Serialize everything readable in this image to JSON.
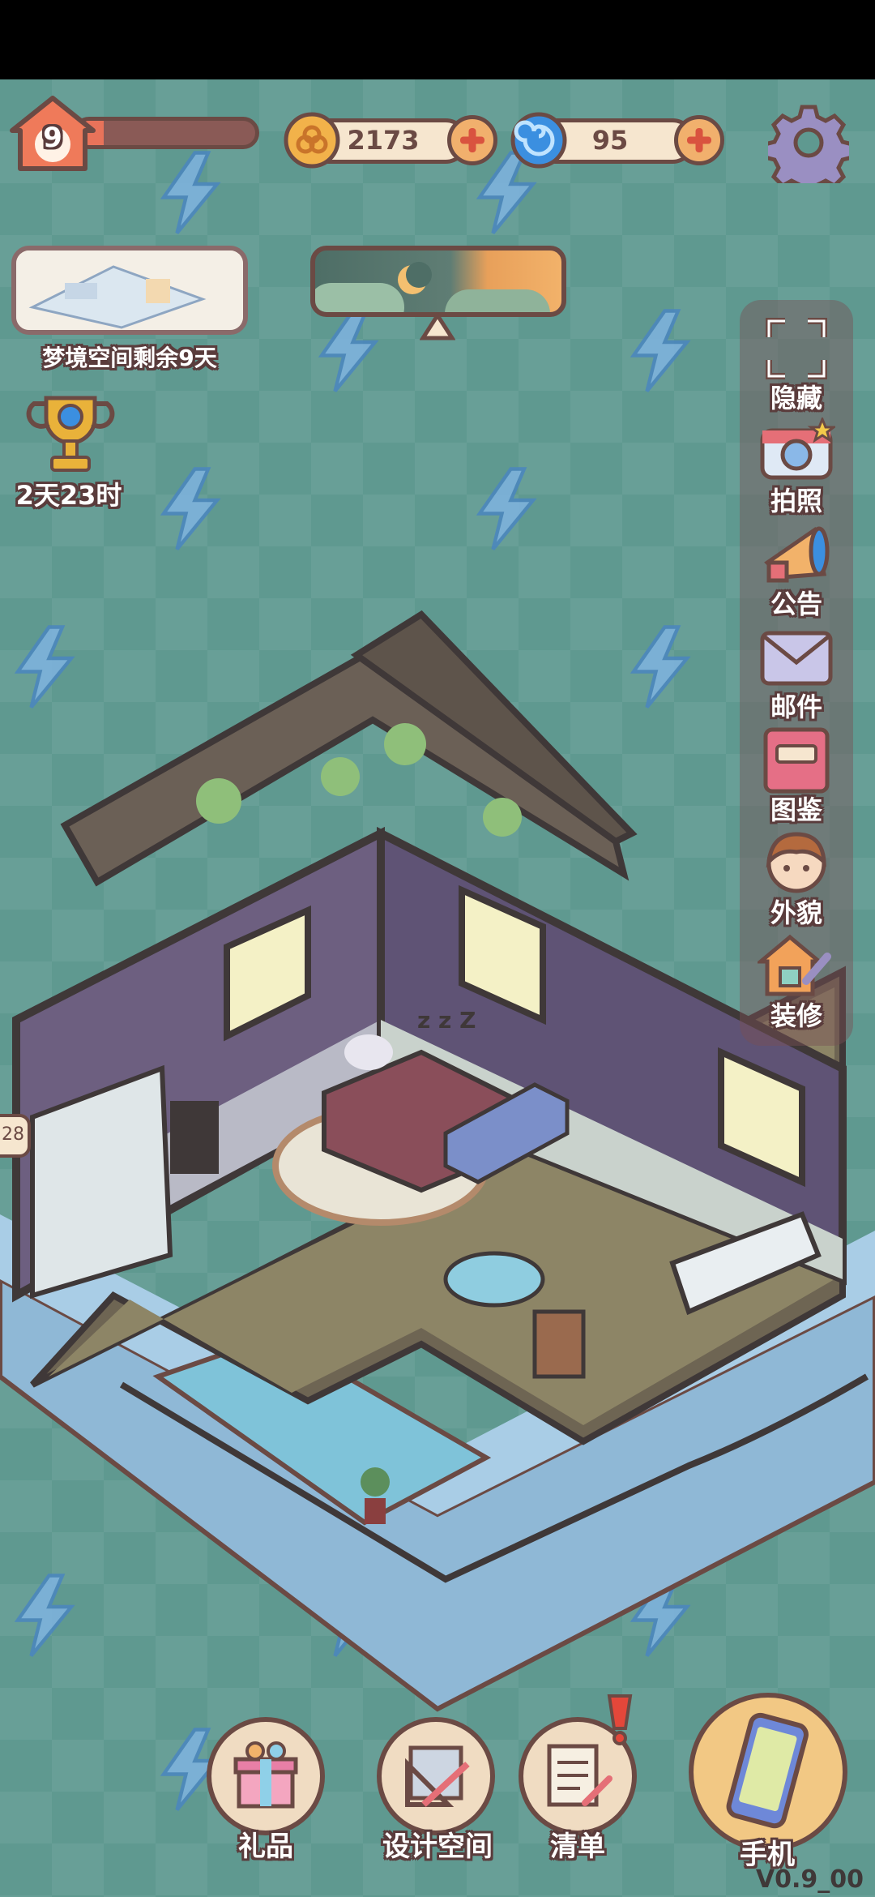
{
  "player": {
    "level": "9",
    "level_progress": 0.15
  },
  "currencies": {
    "coins": {
      "value": "2173",
      "icon": "coin-flower-icon"
    },
    "gems": {
      "value": "95",
      "icon": "blue-swirl-icon"
    }
  },
  "dream_space": {
    "label": "梦境空间剩余9天"
  },
  "trophy": {
    "timer": "2天23时"
  },
  "day_night": {
    "icon": "moon-icon"
  },
  "left_edge_badge": "28",
  "side_menu": {
    "items": [
      {
        "label": "隐藏",
        "icon": "hide-frame-icon"
      },
      {
        "label": "拍照",
        "icon": "camera-icon"
      },
      {
        "label": "公告",
        "icon": "megaphone-icon"
      },
      {
        "label": "邮件",
        "icon": "mail-icon"
      },
      {
        "label": "图鉴",
        "icon": "book-icon"
      },
      {
        "label": "外貌",
        "icon": "avatar-icon"
      },
      {
        "label": "装修",
        "icon": "renovate-icon"
      }
    ]
  },
  "bottom_bar": {
    "gift": "礼品",
    "design": "设计空间",
    "list": "清单",
    "phone": "手机"
  },
  "version": "V0.9_00",
  "colors": {
    "accent": "#f1b06d",
    "outline": "#6b4a44",
    "background": "#5f9990"
  }
}
